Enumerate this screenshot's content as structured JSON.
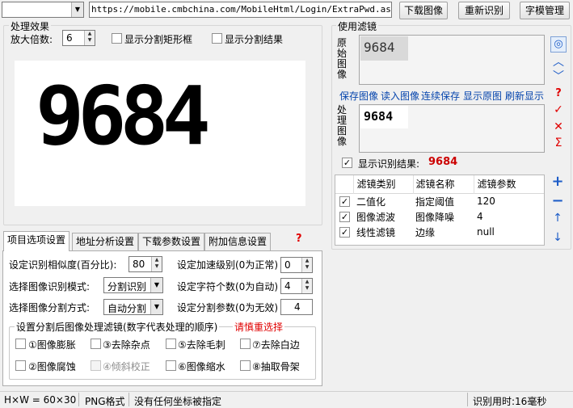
{
  "toolbar": {
    "url_value": "https://mobile.cmbchina.com/MobileHtml/Login/ExtraPwd.aspx?Cli",
    "download_button": "下载图像",
    "rerecognize_button": "重新识别",
    "template_button": "字模管理"
  },
  "preview": {
    "group_title": "处理效果",
    "zoom_label": "放大倍数:",
    "zoom_value": "6",
    "show_rect_label": "显示分割矩形框",
    "show_seg_label": "显示分割结果",
    "captcha_text": "9684"
  },
  "filters": {
    "group_title": "使用滤镜",
    "original_label": "原始图像",
    "processed_label": "处理图像",
    "original_captcha": "9684",
    "processed_captcha": "9684",
    "actions": [
      "保存图像",
      "读入图像",
      "连续保存",
      "显示原图",
      "刷新显示"
    ],
    "show_result_label": "显示识别结果:",
    "result_value": "9684",
    "table_headers": [
      "滤镜类别",
      "滤镜名称",
      "滤镜参数"
    ],
    "rows": [
      {
        "checked": true,
        "category": "二值化",
        "name": "指定阈值",
        "param": "120"
      },
      {
        "checked": true,
        "category": "图像滤波",
        "name": "图像降噪",
        "param": "4"
      },
      {
        "checked": true,
        "category": "线性滤镜",
        "name": "边缘",
        "param": "null"
      }
    ]
  },
  "tabs": [
    "项目选项设置",
    "地址分析设置",
    "下载参数设置",
    "附加信息设置"
  ],
  "options": {
    "similarity_label": "设定识别相似度(百分比):",
    "similarity_value": "80",
    "accel_label": "设定加速级别(0为正常)",
    "accel_value": "0",
    "mode_label": "选择图像识别模式:",
    "mode_value": "分割识别",
    "char_count_label": "设定字符个数(0为自动)",
    "char_count_value": "4",
    "split_label": "选择图像分割方式:",
    "split_value": "自动分割",
    "split_param_label": "设定分割参数(0为无效)",
    "split_param_value": "4",
    "post_group_title": "设置分割后图像处理滤镜(数字代表处理的顺序)",
    "warning": "请慎重选择",
    "post_filters": [
      {
        "label": "①图像膨胀",
        "enabled": true
      },
      {
        "label": "③去除杂点",
        "enabled": true
      },
      {
        "label": "⑤去除毛刺",
        "enabled": true
      },
      {
        "label": "⑦去除白边",
        "enabled": true
      },
      {
        "label": "②图像腐蚀",
        "enabled": true
      },
      {
        "label": "④倾斜校正",
        "enabled": false
      },
      {
        "label": "⑥图像缩水",
        "enabled": true
      },
      {
        "label": "⑧抽取骨架",
        "enabled": true
      }
    ]
  },
  "status": {
    "size": "H×W = 60×30",
    "format": "PNG格式",
    "message": "没有任何坐标被指定",
    "elapsed": "识别用时:16毫秒"
  },
  "icons": {
    "help": "question-mark-icon",
    "sidebar": [
      "target-icon",
      "chevron-up-icon",
      "chevron-down-icon",
      "question-mark-icon",
      "check-icon",
      "close-icon",
      "sigma-icon"
    ],
    "table_side": [
      "plus-icon",
      "minus-icon",
      "arrow-up-icon",
      "arrow-down-icon"
    ]
  },
  "colors": {
    "accent_blue": "#0645ad",
    "warning_red": "#e00000",
    "result_red": "#cc0000"
  }
}
